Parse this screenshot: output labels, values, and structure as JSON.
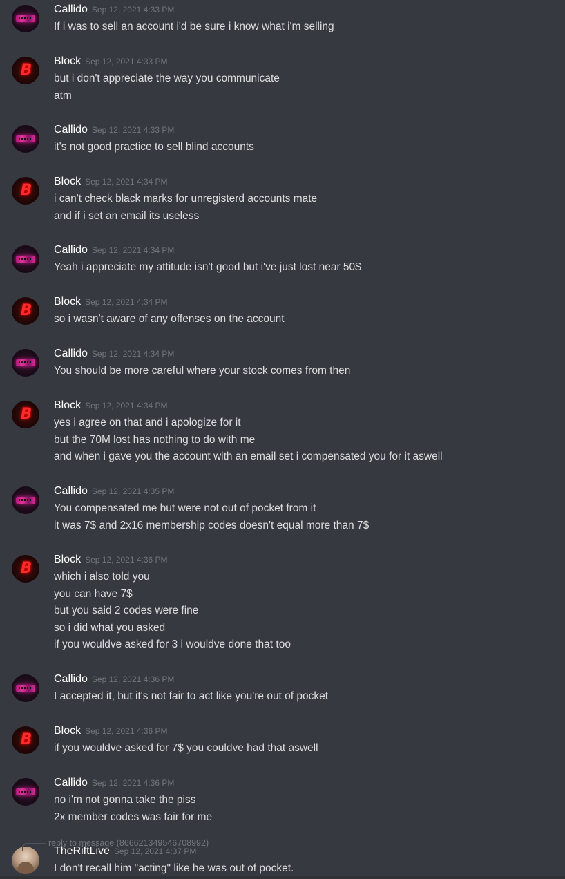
{
  "messages": [
    {
      "author": "Callido",
      "time": "Sep 12, 2021 4:33 PM",
      "lines": [
        "If i was to sell an account i'd be sure i know what i'm selling"
      ]
    },
    {
      "author": "Block",
      "time": "Sep 12, 2021 4:33 PM",
      "lines": [
        "but i don't appreciate the way you communicate",
        "atm"
      ]
    },
    {
      "author": "Callido",
      "time": "Sep 12, 2021 4:33 PM",
      "lines": [
        "it's not good practice to sell blind accounts"
      ]
    },
    {
      "author": "Block",
      "time": "Sep 12, 2021 4:34 PM",
      "lines": [
        "i can't check black marks for unregisterd accounts mate",
        "and if i set an email its useless"
      ]
    },
    {
      "author": "Callido",
      "time": "Sep 12, 2021 4:34 PM",
      "lines": [
        "Yeah i appreciate my attitude isn't good but i've just lost near 50$"
      ]
    },
    {
      "author": "Block",
      "time": "Sep 12, 2021 4:34 PM",
      "lines": [
        "so i wasn't aware of any offenses on the account"
      ]
    },
    {
      "author": "Callido",
      "time": "Sep 12, 2021 4:34 PM",
      "lines": [
        "You should be more careful where your stock comes from then"
      ]
    },
    {
      "author": "Block",
      "time": "Sep 12, 2021 4:34 PM",
      "lines": [
        "yes i agree on that and i apologize for it",
        "but the 70M lost has nothing to do with me",
        "and when i gave you the account with an email set i compensated you for it aswell"
      ]
    },
    {
      "author": "Callido",
      "time": "Sep 12, 2021 4:35 PM",
      "lines": [
        "You compensated me but were not out of pocket from it",
        "it was 7$ and 2x16 membership codes doesn't equal more than 7$"
      ]
    },
    {
      "author": "Block",
      "time": "Sep 12, 2021 4:36 PM",
      "lines": [
        "which i also told you",
        "you can have 7$",
        "but you said 2 codes were fine",
        "so i did what you asked",
        "if you wouldve asked for 3 i wouldve done that too"
      ]
    },
    {
      "author": "Callido",
      "time": "Sep 12, 2021 4:36 PM",
      "lines": [
        "I accepted it, but it's not fair to act like you're out of pocket"
      ]
    },
    {
      "author": "Block",
      "time": "Sep 12, 2021 4:36 PM",
      "lines": [
        "if you wouldve asked for 7$ you couldve had that aswell"
      ]
    },
    {
      "author": "Callido",
      "time": "Sep 12, 2021 4:36 PM",
      "lines": [
        "no i'm not gonna take the piss",
        "2x member codes was fair for me"
      ]
    },
    {
      "author": "TheRiftLive",
      "time": "Sep 12, 2021 4:37 PM",
      "lines": [
        "I don't recall him \"acting\" like he was out of pocket."
      ]
    }
  ],
  "reply": {
    "text": "reply to message (866621349546708992)"
  },
  "avatars": {
    "Callido": "callido-avatar-icon",
    "Block": "block-avatar-icon",
    "TheRiftLive": "therift-avatar-icon"
  },
  "block_avatar_letter": "B"
}
